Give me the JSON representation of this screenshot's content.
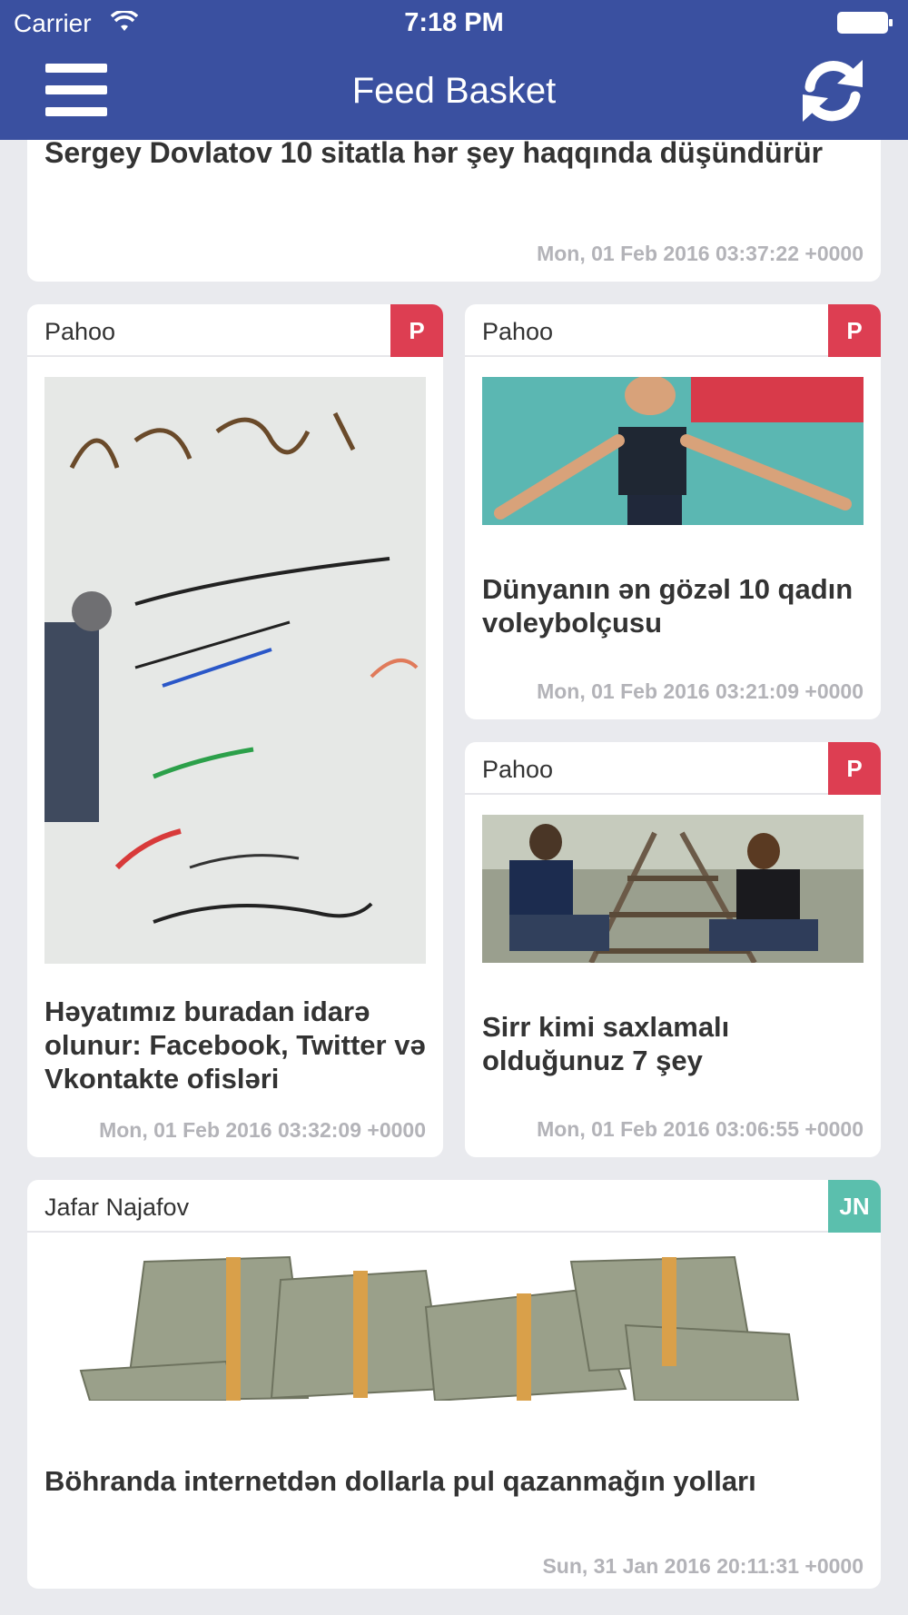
{
  "status_bar": {
    "carrier": "Carrier",
    "time": "7:18 PM"
  },
  "nav": {
    "title": "Feed Basket",
    "menu_icon": "hamburger-menu-icon",
    "refresh_icon": "refresh-icon"
  },
  "colors": {
    "header": "#3a50a0",
    "badge_pahoo": "#dd3e52",
    "badge_jafar": "#5bbfad",
    "background": "#e9eaee"
  },
  "feed": [
    {
      "id": "top",
      "headline": "Sergey Dovlatov 10 sitatla hər şey haqqında düşündürür",
      "date": "Mon, 01 Feb 2016 03:37:22 +0000"
    },
    {
      "id": "card1",
      "source": "Pahoo",
      "badge": "P",
      "headline": "Həyatımız buradan idarə olunur: Facebook, Twitter və Vkontakte ofisləri",
      "date": "Mon, 01 Feb 2016 03:32:09 +0000"
    },
    {
      "id": "card2",
      "source": "Pahoo",
      "badge": "P",
      "headline": "Dünyanın ən gözəl 10 qadın voleybolçusu",
      "date": "Mon, 01 Feb 2016 03:21:09 +0000"
    },
    {
      "id": "card3",
      "source": "Pahoo",
      "badge": "P",
      "headline": "Sirr kimi saxlamalı olduğunuz 7 şey",
      "date": "Mon, 01 Feb 2016 03:06:55 +0000"
    },
    {
      "id": "card4",
      "source": "Jafar Najafov",
      "badge": "JN",
      "headline": "Böhranda internetdən dollarla pul qazanmağın yolları",
      "date": "Sun, 31 Jan 2016 20:11:31 +0000"
    }
  ]
}
